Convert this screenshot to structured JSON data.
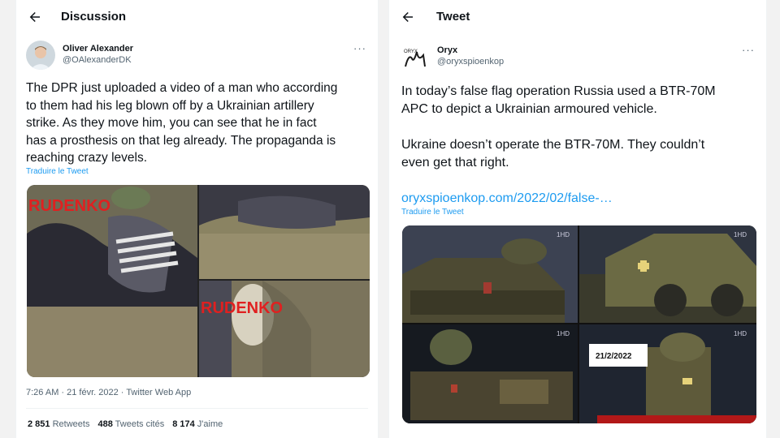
{
  "left": {
    "header": {
      "title": "Discussion"
    },
    "author": {
      "name": "Oliver Alexander",
      "handle": "@OAlexanderDK"
    },
    "more": "···",
    "text": "The DPR just uploaded a video of a man who according to them had his leg blown off by a Ukrainian artillery strike. As they move him, you can see that he in fact has a prosthesis on that leg already. The propaganda is reaching crazy levels.",
    "text_lines": [
      "The DPR just uploaded a video of a man who according",
      "to them had his leg blown off by a Ukrainian artillery",
      "strike. As they move him, you can see that he in fact",
      "has a prosthesis on that leg already. The propaganda is",
      "reaching crazy levels."
    ],
    "translate": "Traduire le Tweet",
    "media": {
      "watermark": "RUDENKO"
    },
    "timestamp": "7:26 AM · 21 févr. 2022 · Twitter Web App",
    "stats": {
      "retweets_count": "2 851",
      "retweets_label": "Retweets",
      "quotes_count": "488",
      "quotes_label": "Tweets cités",
      "likes_count": "8 174",
      "likes_label": "J'aime"
    }
  },
  "right": {
    "header": {
      "title": "Tweet"
    },
    "author": {
      "name": "Oryx",
      "handle": "@oryxspioenkop",
      "logo_text": "ORYX"
    },
    "more": "···",
    "text_lines_1": [
      "In today’s false flag operation Russia used a BTR-70M",
      "APC to depict a Ukrainian armoured vehicle."
    ],
    "text_lines_2": [
      "Ukraine doesn’t operate the BTR-70M. They couldn’t",
      "even get that right."
    ],
    "link": "oryxspioenkop.com/2022/02/false-…",
    "translate": "Traduire le Tweet",
    "media": {
      "date_label": "21/2/2022",
      "channel": "1HD"
    }
  },
  "colors": {
    "link": "#1d9bf0",
    "muted": "#536471",
    "text": "#0f1419"
  }
}
